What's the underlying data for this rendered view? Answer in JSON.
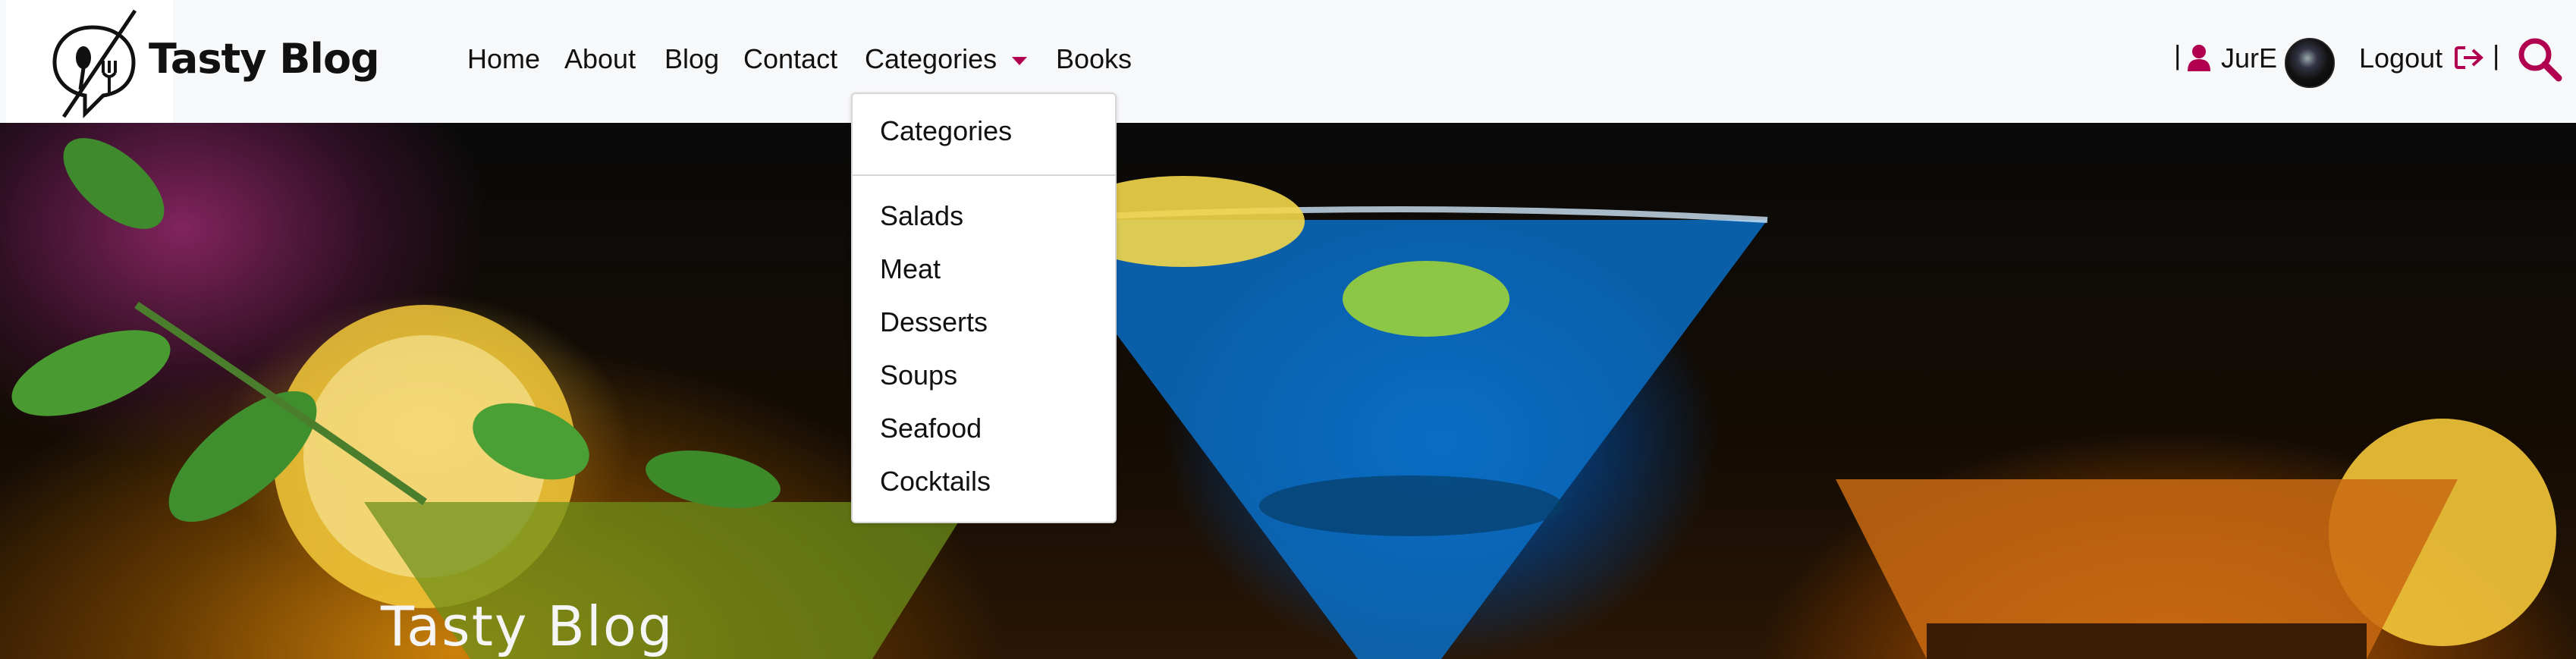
{
  "brand": {
    "name": "Tasty Blog"
  },
  "nav": {
    "home": "Home",
    "about": "About",
    "blog": "Blog",
    "contact": "Contact",
    "categories": "Categories",
    "books": "Books"
  },
  "dropdown": {
    "header": "Categories",
    "items": [
      "Salads",
      "Meat",
      "Desserts",
      "Soups",
      "Seafood",
      "Cocktails"
    ]
  },
  "user": {
    "separator": "|",
    "name": "JurE",
    "logout": "Logout"
  },
  "hero": {
    "title": "Tasty Blog"
  },
  "colors": {
    "accent": "#b0004f",
    "navbar_bg": "#f7f8fa"
  },
  "icons": [
    "logo-icon",
    "caret-down-icon",
    "user-icon",
    "logout-icon",
    "search-icon"
  ]
}
